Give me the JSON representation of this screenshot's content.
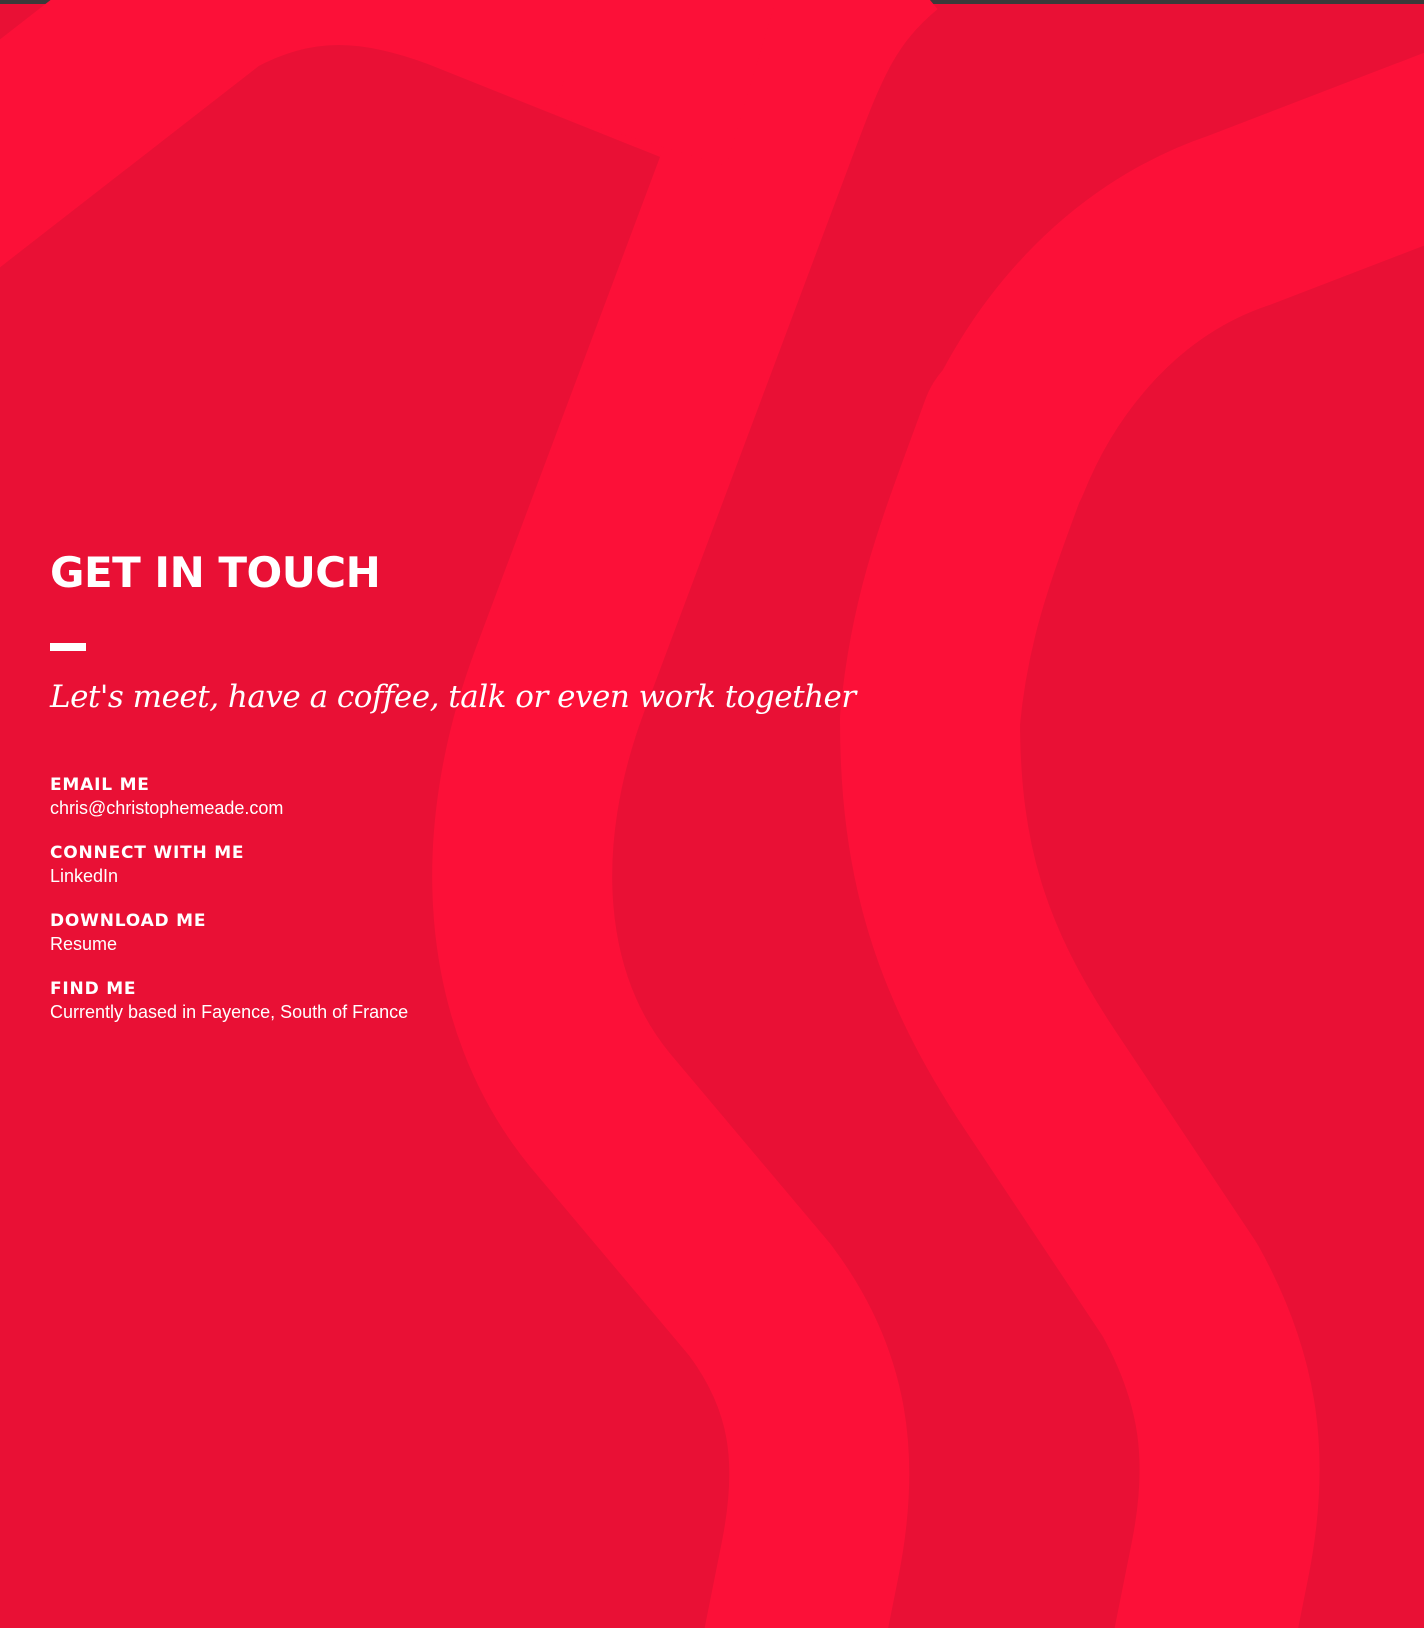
{
  "colors": {
    "background": "#e91035",
    "shape": "#fc1038",
    "text": "#ffffff"
  },
  "page": {
    "title": "GET IN TOUCH",
    "tagline": "Let's meet, have a coffee, talk or even work together"
  },
  "contacts": [
    {
      "label": "EMAIL ME",
      "value": "chris@christophemeade.com"
    },
    {
      "label": "CONNECT WITH ME",
      "value": "LinkedIn"
    },
    {
      "label": "DOWNLOAD ME",
      "value": "Resume"
    },
    {
      "label": "FIND ME",
      "value": "Currently based in Fayence, South of France"
    }
  ]
}
